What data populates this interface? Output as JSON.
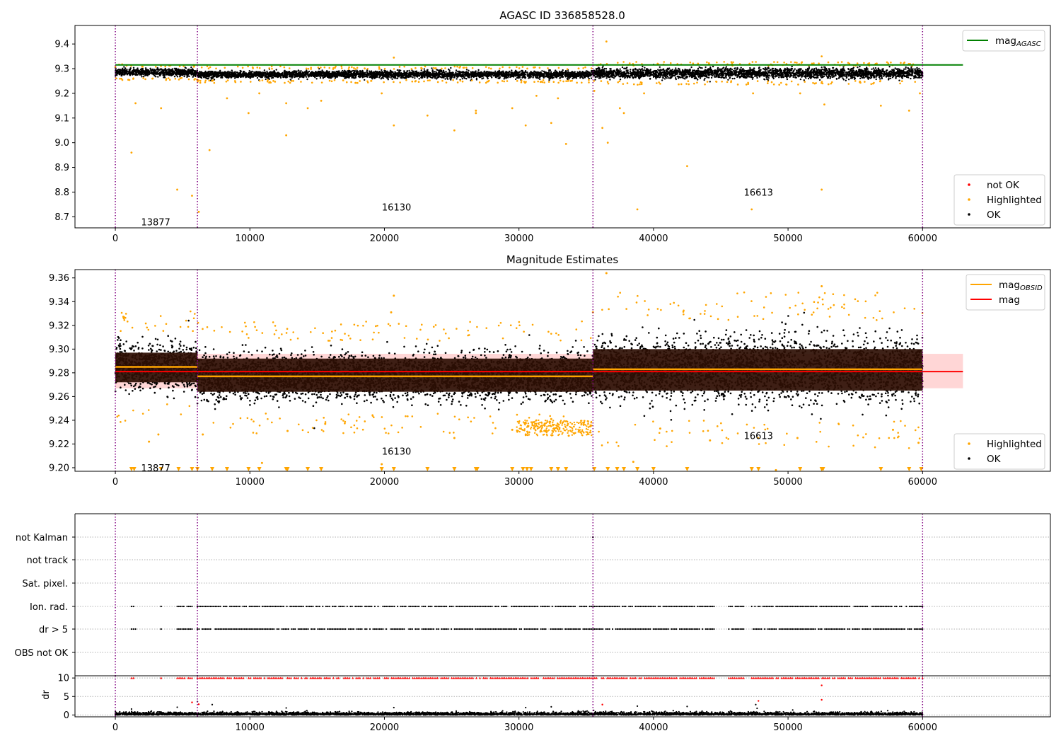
{
  "colors": {
    "ok": "#000000",
    "highlighted": "#ffa500",
    "not_ok": "#ff0000",
    "agasc_line": "#008000",
    "obsid_line": "#ffa500",
    "mag_line": "#ff0000",
    "mag_band": "#ffd6d6",
    "obs_band": "#2e0f04",
    "obs_boundary": "#800080",
    "gridline": "#b0b0b0"
  },
  "chart_data": [
    {
      "type": "scatter",
      "title": "AGASC ID 336858528.0",
      "xlim": [
        -3000,
        69500
      ],
      "ylim": [
        8.655,
        9.475
      ],
      "xticks": [
        0,
        10000,
        20000,
        30000,
        40000,
        50000,
        60000
      ],
      "yticks": [
        8.7,
        8.8,
        8.9,
        9.0,
        9.1,
        9.2,
        9.3,
        9.4
      ],
      "ytick_labels": [
        "8.7",
        "8.8",
        "8.9",
        "9.0",
        "9.1",
        "9.2",
        "9.3",
        "9.4"
      ],
      "obs_boundaries": [
        0,
        6100,
        35500,
        60000
      ],
      "obs_labels": [
        {
          "text": "13877",
          "x": 3000,
          "y": 8.68
        },
        {
          "text": "16130",
          "x": 20900,
          "y": 8.74
        },
        {
          "text": "16613",
          "x": 47800,
          "y": 8.8
        }
      ],
      "hlines": [
        {
          "name": "mag_AGASC",
          "y": 9.315,
          "color": "#008000",
          "x0": 0,
          "x1": 63000
        }
      ],
      "series": [
        {
          "name": "not OK",
          "color": "#ff0000"
        },
        {
          "name": "Highlighted",
          "color": "#ffa500"
        },
        {
          "name": "OK",
          "color": "#000000"
        }
      ],
      "segments": [
        {
          "x0": 0,
          "x1": 6100,
          "center": 9.285,
          "spread": 0.013
        },
        {
          "x0": 6100,
          "x1": 35500,
          "center": 9.276,
          "spread": 0.013
        },
        {
          "x0": 35500,
          "x1": 60000,
          "center": 9.281,
          "spread": 0.018
        }
      ],
      "outliers": [
        [
          1200,
          8.96
        ],
        [
          1500,
          9.16
        ],
        [
          3400,
          9.14
        ],
        [
          4600,
          8.81
        ],
        [
          5700,
          8.785
        ],
        [
          6200,
          8.72
        ],
        [
          7000,
          8.97
        ],
        [
          8300,
          9.18
        ],
        [
          9900,
          9.12
        ],
        [
          10700,
          9.2
        ],
        [
          12700,
          9.03
        ],
        [
          12700,
          9.16
        ],
        [
          14300,
          9.14
        ],
        [
          15300,
          9.17
        ],
        [
          19800,
          9.2
        ],
        [
          20700,
          9.07
        ],
        [
          23200,
          9.11
        ],
        [
          25200,
          9.05
        ],
        [
          26800,
          9.13
        ],
        [
          26800,
          9.12
        ],
        [
          29500,
          9.14
        ],
        [
          30500,
          9.07
        ],
        [
          31300,
          9.19
        ],
        [
          32400,
          9.08
        ],
        [
          32900,
          9.18
        ],
        [
          33500,
          8.995
        ],
        [
          35600,
          9.21
        ],
        [
          36200,
          9.06
        ],
        [
          36600,
          9.0
        ],
        [
          37500,
          9.14
        ],
        [
          37800,
          9.12
        ],
        [
          38800,
          8.73
        ],
        [
          39300,
          9.2
        ],
        [
          42500,
          8.905
        ],
        [
          47300,
          8.73
        ],
        [
          47400,
          9.2
        ],
        [
          50900,
          9.2
        ],
        [
          52500,
          8.81
        ],
        [
          52700,
          9.155
        ],
        [
          56900,
          9.15
        ],
        [
          59000,
          9.13
        ],
        [
          59800,
          9.2
        ],
        [
          36500,
          9.41
        ],
        [
          20700,
          9.345
        ],
        [
          52500,
          9.35
        ]
      ],
      "legends": [
        {
          "position": "upper-right",
          "entries": [
            {
              "label": "mag",
              "sub": "AGASC",
              "kind": "line",
              "color": "#008000"
            }
          ]
        },
        {
          "position": "lower-right",
          "entries": [
            {
              "label": "not OK",
              "kind": "dot",
              "color": "#ff0000"
            },
            {
              "label": "Highlighted",
              "kind": "dot",
              "color": "#ffa500"
            },
            {
              "label": "OK",
              "kind": "dot",
              "color": "#000000"
            }
          ]
        }
      ]
    },
    {
      "type": "scatter",
      "title": "Magnitude Estimates",
      "xlim": [
        -3000,
        69500
      ],
      "ylim": [
        9.197,
        9.367
      ],
      "xticks": [
        0,
        10000,
        20000,
        30000,
        40000,
        50000,
        60000
      ],
      "yticks": [
        9.2,
        9.22,
        9.24,
        9.26,
        9.28,
        9.3,
        9.32,
        9.34,
        9.36
      ],
      "ytick_labels": [
        "9.20",
        "9.22",
        "9.24",
        "9.26",
        "9.28",
        "9.30",
        "9.32",
        "9.34",
        "9.36"
      ],
      "obs_boundaries": [
        0,
        6100,
        35500,
        60000
      ],
      "obs_labels": [
        {
          "text": "13877",
          "x": 3000,
          "y": 9.2
        },
        {
          "text": "16130",
          "x": 20900,
          "y": 9.214
        },
        {
          "text": "16613",
          "x": 47800,
          "y": 9.227
        }
      ],
      "mag": 9.281,
      "mag_band": [
        9.267,
        9.296
      ],
      "mag_line_x": [
        0,
        63000
      ],
      "segments": [
        {
          "x0": 0,
          "x1": 6100,
          "mean": 9.285,
          "band": [
            9.272,
            9.297
          ],
          "spread": 0.013
        },
        {
          "x0": 6100,
          "x1": 35500,
          "mean": 9.277,
          "band": [
            9.264,
            9.292
          ],
          "spread": 0.013
        },
        {
          "x0": 35500,
          "x1": 60000,
          "mean": 9.283,
          "band": [
            9.265,
            9.3
          ],
          "spread": 0.018
        }
      ],
      "series": [
        {
          "name": "Highlighted",
          "color": "#ffa500"
        },
        {
          "name": "OK",
          "color": "#000000"
        }
      ],
      "lines": [
        {
          "name": "mag_OBSID",
          "color": "#ffa500"
        },
        {
          "name": "mag",
          "color": "#ff0000"
        }
      ],
      "floor_markers_x": [
        1200,
        1400,
        3400,
        4700,
        5700,
        6100,
        7200,
        8300,
        9900,
        10700,
        12700,
        12800,
        14300,
        15300,
        19800,
        20700,
        23200,
        25200,
        26800,
        26900,
        29500,
        30300,
        30600,
        30900,
        32400,
        32900,
        33500,
        35600,
        36600,
        37300,
        37800,
        38800,
        40000,
        42500,
        47300,
        47800,
        50900,
        52500,
        52600,
        56900,
        59000,
        59900
      ],
      "outliers": [
        [
          20700,
          9.345
        ],
        [
          52500,
          9.353
        ],
        [
          36500,
          9.364
        ],
        [
          20500,
          9.331
        ],
        [
          35500,
          9.331
        ],
        [
          6500,
          9.228
        ],
        [
          10900,
          9.204
        ],
        [
          12800,
          9.231
        ],
        [
          15600,
          9.237
        ],
        [
          19800,
          9.203
        ],
        [
          25200,
          9.225
        ],
        [
          29500,
          9.232
        ],
        [
          32400,
          9.241
        ],
        [
          33700,
          9.227
        ],
        [
          40500,
          9.233
        ],
        [
          44200,
          9.223
        ],
        [
          50700,
          9.225
        ],
        [
          57800,
          9.232
        ],
        [
          59700,
          9.221
        ],
        [
          3200,
          9.228
        ],
        [
          2500,
          9.222
        ],
        [
          38500,
          9.205
        ],
        [
          49100,
          9.198
        ]
      ],
      "legends": [
        {
          "position": "upper-right",
          "entries": [
            {
              "label": "mag",
              "sub": "OBSID",
              "kind": "line",
              "color": "#ffa500"
            },
            {
              "label": "mag",
              "kind": "line",
              "color": "#ff0000"
            }
          ]
        },
        {
          "position": "lower-right",
          "entries": [
            {
              "label": "Highlighted",
              "kind": "dot",
              "color": "#ffa500"
            },
            {
              "label": "OK",
              "kind": "dot",
              "color": "#000000"
            }
          ]
        }
      ]
    },
    {
      "type": "scatter",
      "title": "",
      "xlim": [
        -3000,
        69500
      ],
      "categories": [
        "not Kalman",
        "not track",
        "Sat. pixel.",
        "Ion. rad.",
        "dr > 5",
        "OBS not OK"
      ],
      "obs_boundaries": [
        0,
        6100,
        35500,
        60000
      ],
      "flag_rows": [
        {
          "category": "Ion. rad.",
          "ranges": [
            [
              1200,
              1500
            ],
            [
              3400,
              3400
            ],
            [
              4600,
              5700
            ],
            [
              6100,
              35500
            ],
            [
              35500,
              44500
            ],
            [
              45600,
              46700
            ],
            [
              47300,
              60000
            ]
          ]
        },
        {
          "category": "dr > 5",
          "ranges": [
            [
              1200,
              1500
            ],
            [
              3400,
              3400
            ],
            [
              4600,
              5700
            ],
            [
              6100,
              35500
            ],
            [
              35500,
              44500
            ],
            [
              45600,
              46700
            ],
            [
              47300,
              60000
            ]
          ]
        },
        {
          "category": "not Kalman",
          "points": [
            35500
          ]
        }
      ]
    },
    {
      "type": "scatter",
      "title": "",
      "ylabel": "dr",
      "xlim": [
        -3000,
        69500
      ],
      "ylim": [
        -0.5,
        10.6
      ],
      "xticks": [
        0,
        10000,
        20000,
        30000,
        40000,
        50000,
        60000
      ],
      "yticks": [
        0,
        5,
        10
      ],
      "ytick_labels": [
        "0",
        "5",
        "10"
      ],
      "obs_boundaries": [
        0,
        6100,
        35500,
        60000
      ],
      "clipped_ranges": [
        [
          1200,
          1500
        ],
        [
          3400,
          3400
        ],
        [
          4600,
          5700
        ],
        [
          6100,
          35500
        ],
        [
          35500,
          44500
        ],
        [
          45600,
          46700
        ],
        [
          47300,
          60000
        ]
      ],
      "clipped_value": 10,
      "not_ok_points": [
        [
          5700,
          3.4
        ],
        [
          6200,
          2.9
        ],
        [
          36200,
          2.8
        ],
        [
          47800,
          3.8
        ],
        [
          52500,
          8.0
        ],
        [
          52500,
          4.1
        ]
      ],
      "ok_points": [
        [
          1200,
          1.6
        ],
        [
          4600,
          2.1
        ],
        [
          6100,
          3.6
        ],
        [
          7200,
          2.8
        ],
        [
          12700,
          1.9
        ],
        [
          20700,
          2.0
        ],
        [
          30500,
          2.0
        ],
        [
          32400,
          2.2
        ],
        [
          38800,
          2.4
        ],
        [
          42500,
          2.3
        ],
        [
          47600,
          2.8
        ],
        [
          47700,
          1.8
        ]
      ]
    }
  ]
}
